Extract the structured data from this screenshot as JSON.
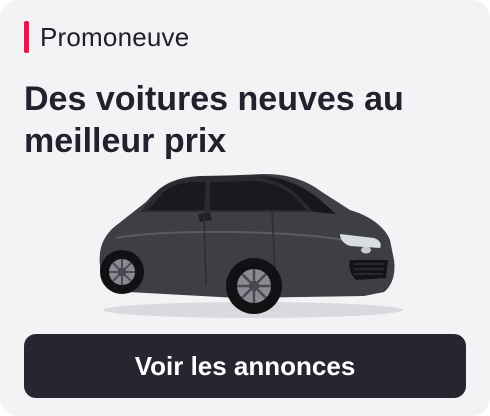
{
  "brand": {
    "name": "Promoneuve",
    "accent_color": "#e8174a"
  },
  "headline": "Des voitures neuves au meilleur prix",
  "image": {
    "subject": "car-icon"
  },
  "cta": {
    "label": "Voir les annonces",
    "background": "#262630"
  }
}
